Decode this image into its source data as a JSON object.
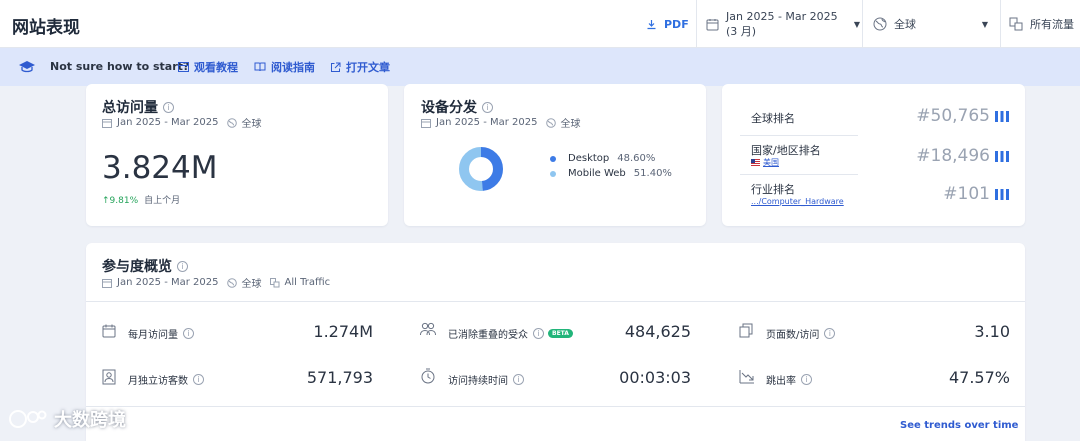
{
  "header": {
    "title": "网站表现",
    "pdf_label": "PDF",
    "date_range": "Jan 2025 - Mar 2025 (3 月)",
    "region": "全球",
    "traffic": "所有流量"
  },
  "helpbar": {
    "question": "Not sure how to start?",
    "links": [
      "观看教程",
      "阅读指南",
      "打开文章"
    ]
  },
  "visits_card": {
    "title": "总访问量",
    "date": "Jan 2025 - Mar 2025",
    "region": "全球",
    "value": "3.824M",
    "delta": "↑9.81%",
    "delta_note": "自上个月"
  },
  "device_card": {
    "title": "设备分发",
    "date": "Jan 2025 - Mar 2025",
    "region": "全球",
    "items": [
      {
        "label": "Desktop",
        "value": "48.60%",
        "share": 48.6,
        "color": "#3d7be6"
      },
      {
        "label": "Mobile Web",
        "value": "51.40%",
        "share": 51.4,
        "color": "#8fc6f0"
      }
    ]
  },
  "rank_card": {
    "global_label": "全球排名",
    "global_value": "#50,765",
    "country_label": "国家/地区排名",
    "country_sub": "美国",
    "country_value": "#18,496",
    "industry_label": "行业排名",
    "industry_sub": ".../Computer_Hardware",
    "industry_value": "#101"
  },
  "engagement": {
    "title": "参与度概览",
    "date": "Jan 2025 - Mar 2025",
    "region": "全球",
    "traffic": "All Traffic",
    "beta": "BETA",
    "metrics": [
      {
        "label": "每月访问量",
        "value": "1.274M"
      },
      {
        "label": "已消除重叠的受众",
        "value": "484,625"
      },
      {
        "label": "页面数/访问",
        "value": "3.10"
      },
      {
        "label": "月独立访客数",
        "value": "571,793"
      },
      {
        "label": "访问持续时间",
        "value": "00:03:03"
      },
      {
        "label": "跳出率",
        "value": "47.57%"
      }
    ],
    "trends_link": "See trends over time"
  },
  "watermark": "大数跨境",
  "colors": {
    "accent": "#2f6fe0",
    "positive": "#24a35a",
    "desktop": "#3d7be6",
    "mobile": "#8fc6f0"
  }
}
